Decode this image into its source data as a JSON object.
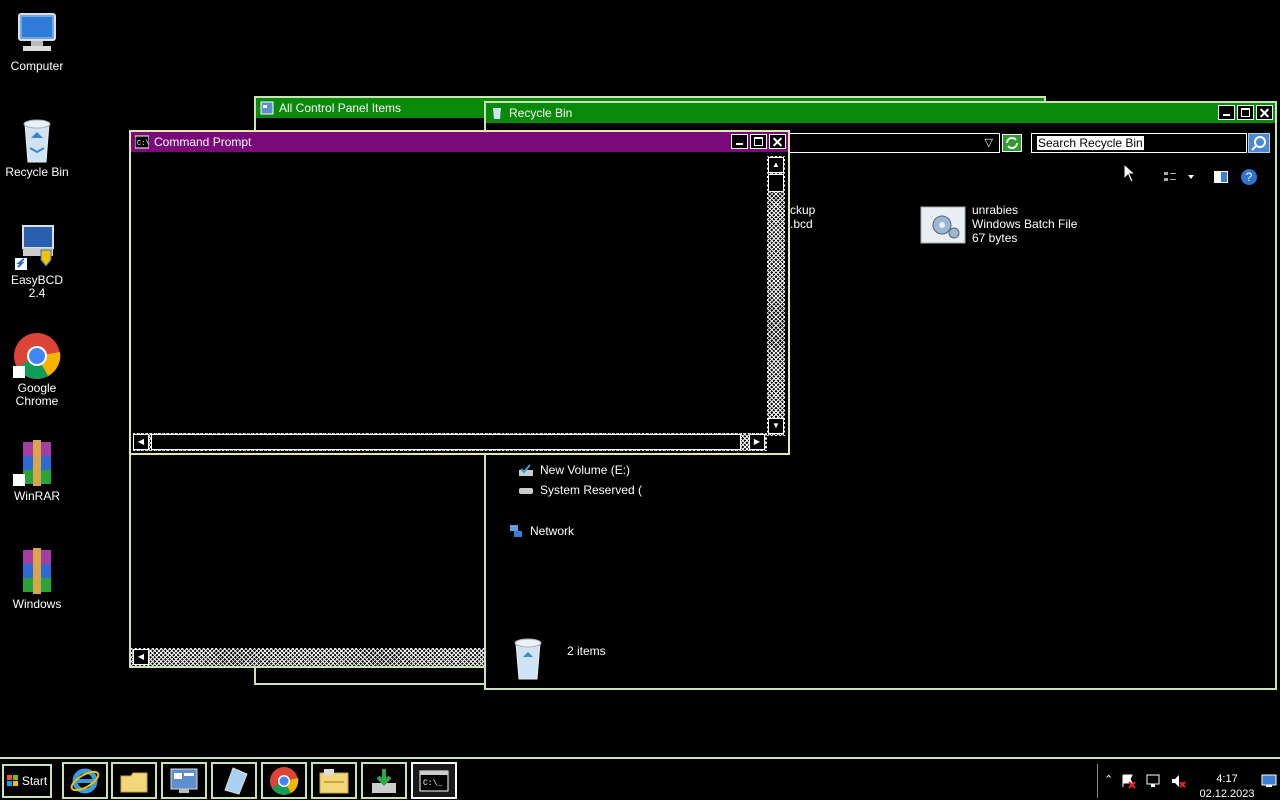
{
  "desktop": {
    "icons": [
      {
        "label": "Computer",
        "icon": "computer-icon"
      },
      {
        "label": "Recycle Bin",
        "icon": "recycle-bin-icon"
      },
      {
        "label": "EasyBCD 2.4",
        "icon": "easybcd-icon"
      },
      {
        "label": "Google Chrome",
        "icon": "chrome-icon"
      },
      {
        "label": "WinRAR",
        "icon": "winrar-icon"
      },
      {
        "label": "Windows",
        "icon": "winrar-archive-icon"
      }
    ]
  },
  "control_panel": {
    "title": "All Control Panel Items"
  },
  "recycle_bin": {
    "title": "Recycle Bin",
    "search_placeholder": "Search Recycle Bin",
    "files": [
      {
        "name_fragment": "ckup",
        "type_fragment": ".bcd"
      },
      {
        "name": "unrabies",
        "type": "Windows Batch File",
        "size": "67 bytes"
      }
    ],
    "tree": [
      {
        "label": "New Volume (E:)",
        "icon": "drive-icon"
      },
      {
        "label": "System Reserved (",
        "icon": "drive-icon"
      },
      {
        "label": "Network",
        "icon": "network-icon"
      }
    ],
    "status": "2 items"
  },
  "command_prompt": {
    "title": "Command Prompt",
    "content": ""
  },
  "taskbar": {
    "start_label": "Start",
    "apps": [
      "internet-explorer-icon",
      "folder-icon",
      "control-panel-icon",
      "notepad-icon",
      "chrome-icon",
      "file-explorer-icon",
      "download-icon",
      "cmd-icon"
    ],
    "clock_time": "4:17",
    "clock_date": "02.12.2023"
  },
  "colors": {
    "title_green": "#0a8a0a",
    "title_purple": "#7a097a",
    "border": "#c9e3b4"
  }
}
